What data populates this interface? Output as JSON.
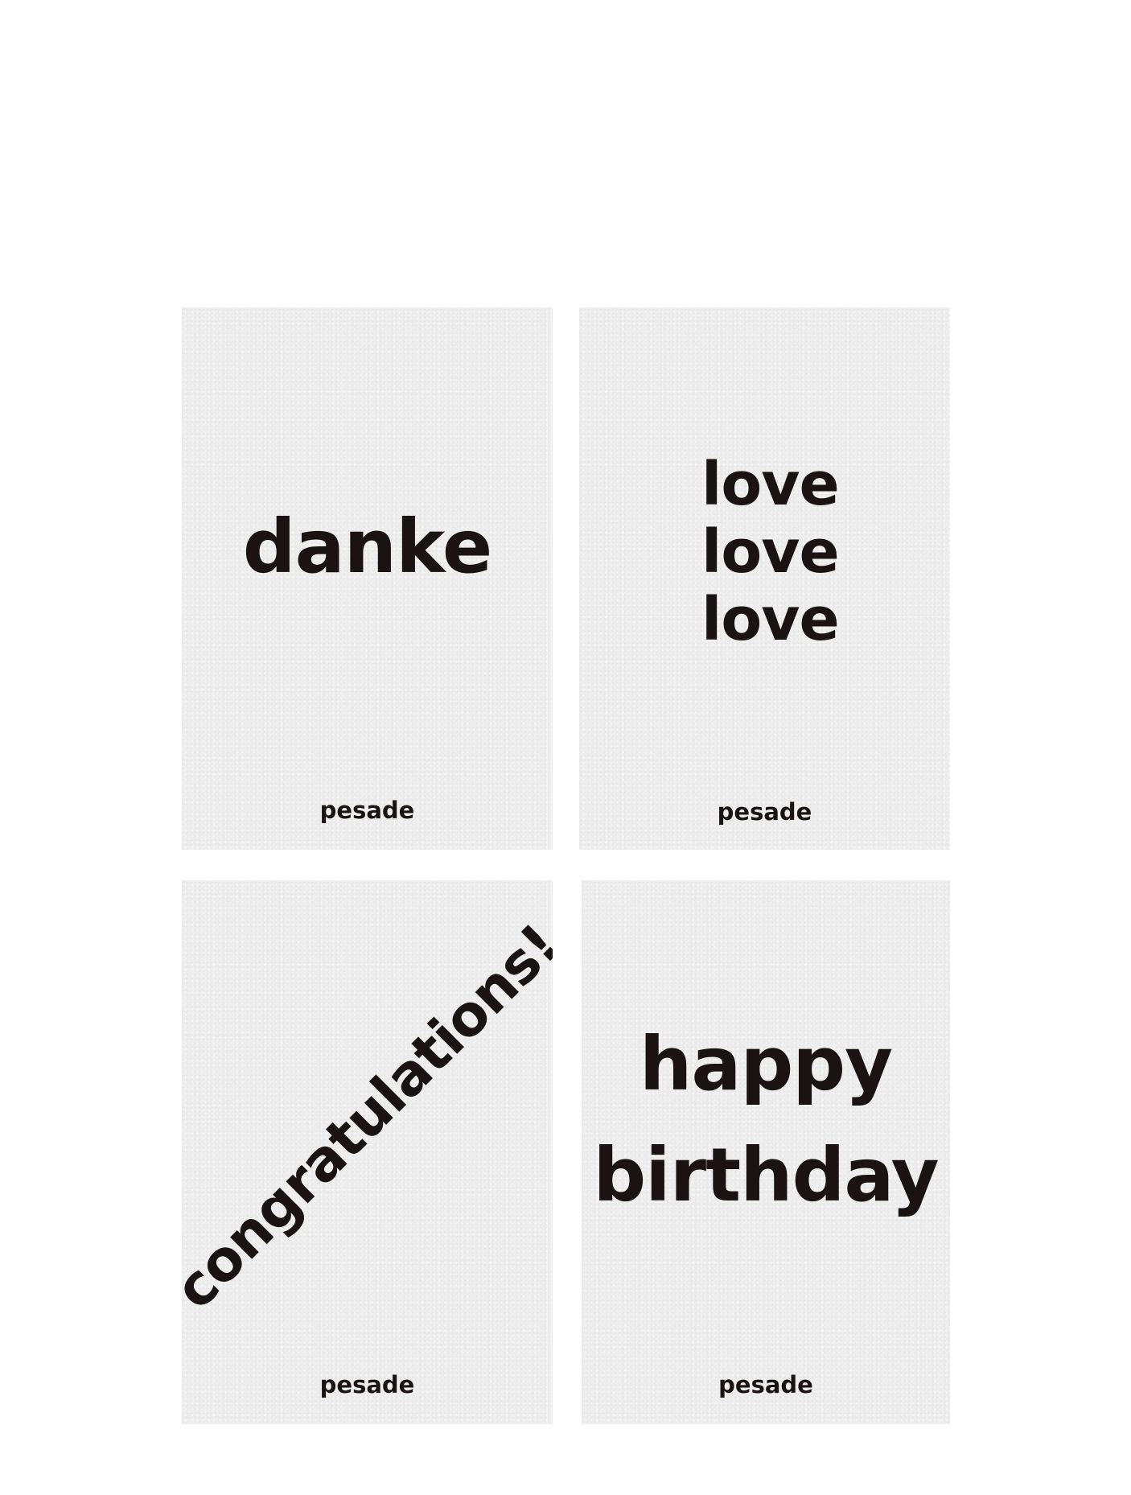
{
  "cards": {
    "danke": {
      "message": "danke",
      "brand": "pesade"
    },
    "love": {
      "lines": [
        "love",
        "love",
        "love"
      ],
      "brand": "pesade"
    },
    "congrats": {
      "message": "congratulations!",
      "brand": "pesade"
    },
    "birthday": {
      "lines": [
        "happy",
        "birthday"
      ],
      "brand": "pesade"
    }
  },
  "colors": {
    "page_background": "#ffffff",
    "card_paper": "#efefef",
    "ink": "#1b1311"
  }
}
